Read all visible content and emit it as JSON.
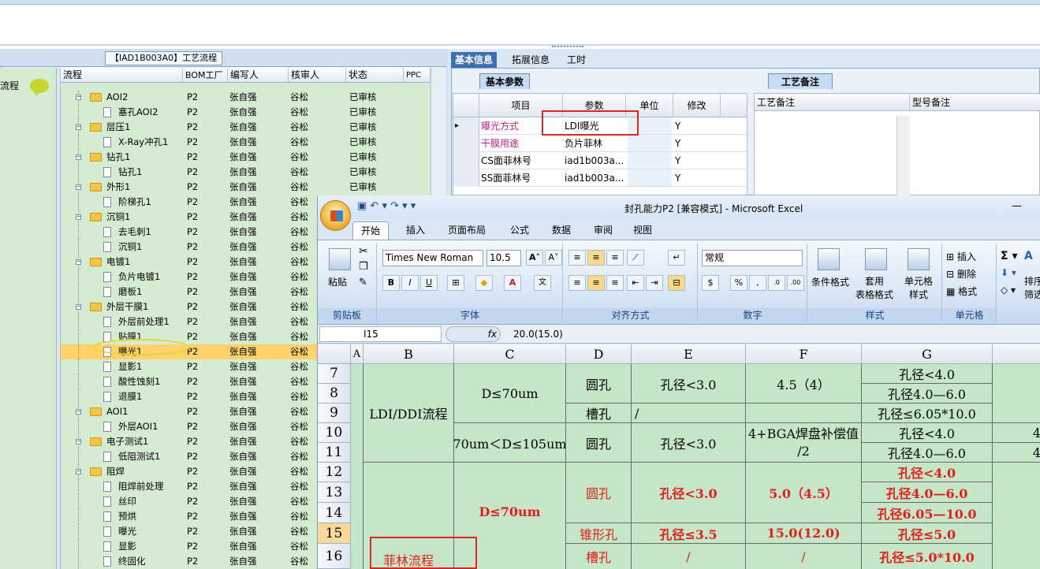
{
  "left_panel": {
    "title": "【IAD1B003A0】工艺流程",
    "nav_label": "流程",
    "columns": [
      "流程",
      "BOM工厂",
      "编写人",
      "核审人",
      "状态",
      "PPC"
    ],
    "rows": [
      {
        "name": "AOI2",
        "level": 1,
        "type": "folder",
        "bom": "P2",
        "writer": "张自强",
        "reviewer": "谷松",
        "status": "已审核"
      },
      {
        "name": "塞孔AOI2",
        "level": 2,
        "type": "doc",
        "bom": "P2",
        "writer": "张自强",
        "reviewer": "谷松",
        "status": "已审核"
      },
      {
        "name": "层压1",
        "level": 1,
        "type": "folder",
        "bom": "P2",
        "writer": "张自强",
        "reviewer": "谷松",
        "status": "已审核"
      },
      {
        "name": "X-Ray冲孔1",
        "level": 2,
        "type": "doc",
        "bom": "P2",
        "writer": "张自强",
        "reviewer": "谷松",
        "status": "已审核"
      },
      {
        "name": "钻孔1",
        "level": 1,
        "type": "folder",
        "bom": "P2",
        "writer": "张自强",
        "reviewer": "谷松",
        "status": "已审核"
      },
      {
        "name": "钻孔1",
        "level": 2,
        "type": "doc",
        "bom": "P2",
        "writer": "张自强",
        "reviewer": "谷松",
        "status": "已审核"
      },
      {
        "name": "外形1",
        "level": 1,
        "type": "folder",
        "bom": "P2",
        "writer": "张自强",
        "reviewer": "谷松",
        "status": "已审核"
      },
      {
        "name": "阶梯孔1",
        "level": 2,
        "type": "doc",
        "bom": "P2",
        "writer": "张自强",
        "reviewer": "谷松",
        "status": "已审核"
      },
      {
        "name": "沉铜1",
        "level": 1,
        "type": "folder",
        "bom": "P2",
        "writer": "张自强",
        "reviewer": "谷松",
        "status": ""
      },
      {
        "name": "去毛刺1",
        "level": 2,
        "type": "doc",
        "bom": "P2",
        "writer": "张自强",
        "reviewer": "谷松",
        "status": ""
      },
      {
        "name": "沉铜1",
        "level": 2,
        "type": "doc",
        "bom": "P2",
        "writer": "张自强",
        "reviewer": "谷松",
        "status": ""
      },
      {
        "name": "电镀1",
        "level": 1,
        "type": "folder",
        "bom": "P2",
        "writer": "张自强",
        "reviewer": "谷松",
        "status": ""
      },
      {
        "name": "负片电镀1",
        "level": 2,
        "type": "doc",
        "bom": "P2",
        "writer": "张自强",
        "reviewer": "谷松",
        "status": ""
      },
      {
        "name": "磨板1",
        "level": 2,
        "type": "doc",
        "bom": "P2",
        "writer": "张自强",
        "reviewer": "谷松",
        "status": ""
      },
      {
        "name": "外层干膜1",
        "level": 1,
        "type": "folder",
        "bom": "P2",
        "writer": "张自强",
        "reviewer": "谷松",
        "status": ""
      },
      {
        "name": "外层前处理1",
        "level": 2,
        "type": "doc",
        "bom": "P2",
        "writer": "张自强",
        "reviewer": "谷松",
        "status": ""
      },
      {
        "name": "贴膜1",
        "level": 2,
        "type": "doc",
        "bom": "P2",
        "writer": "张自强",
        "reviewer": "谷松",
        "status": ""
      },
      {
        "name": "曝光1",
        "level": 2,
        "type": "doc",
        "bom": "P2",
        "writer": "张自强",
        "reviewer": "谷松",
        "status": "",
        "selected": true
      },
      {
        "name": "显影1",
        "level": 2,
        "type": "doc",
        "bom": "P2",
        "writer": "张自强",
        "reviewer": "谷松",
        "status": ""
      },
      {
        "name": "酸性蚀刻1",
        "level": 2,
        "type": "doc",
        "bom": "P2",
        "writer": "张自强",
        "reviewer": "谷松",
        "status": ""
      },
      {
        "name": "退膜1",
        "level": 2,
        "type": "doc",
        "bom": "P2",
        "writer": "张自强",
        "reviewer": "谷松",
        "status": ""
      },
      {
        "name": "AOI1",
        "level": 1,
        "type": "folder",
        "bom": "P2",
        "writer": "张自强",
        "reviewer": "谷松",
        "status": ""
      },
      {
        "name": "外层AOI1",
        "level": 2,
        "type": "doc",
        "bom": "P2",
        "writer": "张自强",
        "reviewer": "谷松",
        "status": ""
      },
      {
        "name": "电子测试1",
        "level": 1,
        "type": "folder",
        "bom": "P2",
        "writer": "张自强",
        "reviewer": "谷松",
        "status": ""
      },
      {
        "name": "低阻测试1",
        "level": 2,
        "type": "doc",
        "bom": "P2",
        "writer": "张自强",
        "reviewer": "谷松",
        "status": ""
      },
      {
        "name": "阻焊",
        "level": 1,
        "type": "folder",
        "bom": "P2",
        "writer": "张自强",
        "reviewer": "谷松",
        "status": ""
      },
      {
        "name": "阻焊前处理",
        "level": 2,
        "type": "doc",
        "bom": "P2",
        "writer": "张自强",
        "reviewer": "谷松",
        "status": ""
      },
      {
        "name": "丝印",
        "level": 2,
        "type": "doc",
        "bom": "P2",
        "writer": "张自强",
        "reviewer": "谷松",
        "status": ""
      },
      {
        "name": "预烘",
        "level": 2,
        "type": "doc",
        "bom": "P2",
        "writer": "张自强",
        "reviewer": "谷松",
        "status": ""
      },
      {
        "name": "曝光",
        "level": 2,
        "type": "doc",
        "bom": "P2",
        "writer": "张自强",
        "reviewer": "谷松",
        "status": ""
      },
      {
        "name": "显影",
        "level": 2,
        "type": "doc",
        "bom": "P2",
        "writer": "张自强",
        "reviewer": "谷松",
        "status": ""
      },
      {
        "name": "终固化",
        "level": 2,
        "type": "doc",
        "bom": "P2",
        "writer": "张自强",
        "reviewer": "谷松",
        "status": ""
      }
    ]
  },
  "right_panel": {
    "tabs": [
      "基本信息",
      "拓展信息",
      "工时"
    ],
    "params_tab": "基本参数",
    "notes_tab": "工艺备注",
    "params_columns": [
      "项目",
      "参数",
      "单位",
      "修改"
    ],
    "params_rows": [
      {
        "item": "曝光方式",
        "value": "LDI曝光",
        "unit": "",
        "edit": "Y",
        "red": true
      },
      {
        "item": "干膜用途",
        "value": "负片菲林",
        "unit": "",
        "edit": "Y",
        "red": true
      },
      {
        "item": "CS面菲林号",
        "value": "iad1b003a...",
        "unit": "",
        "edit": "Y",
        "red": false
      },
      {
        "item": "SS面菲林号",
        "value": "iad1b003a...",
        "unit": "",
        "edit": "Y",
        "red": false
      }
    ],
    "notes_columns": [
      "工艺备注",
      "型号备注"
    ]
  },
  "excel": {
    "title": "封孔能力P2 [兼容模式] - Microsoft Excel",
    "tabs": [
      "开始",
      "插入",
      "页面布局",
      "公式",
      "数据",
      "审阅",
      "视图"
    ],
    "font_name": "Times New Roman",
    "font_size": "10.5",
    "number_format": "常规",
    "groups": {
      "clipboard": "剪贴板",
      "font": "字体",
      "align": "对齐方式",
      "number": "数字",
      "style": "样式",
      "cells": "单元格"
    },
    "buttons": {
      "paste": "粘贴",
      "cond_format": "条件格式",
      "table_format": "套用\n表格格式",
      "cell_style": "单元格\n样式",
      "insert": "插入",
      "delete": "删除",
      "format": "格式",
      "sort": "排序\n筛选"
    },
    "cell_ref": "I15",
    "formula": "20.0(15.0)",
    "columns": [
      "A",
      "B",
      "C",
      "D",
      "E",
      "F",
      "G"
    ],
    "rows": [
      "7",
      "8",
      "9",
      "10",
      "11",
      "12",
      "13",
      "14",
      "15",
      "16"
    ],
    "cells": {
      "b_ldi": "LDI/DDI流程",
      "b_film": "菲林流程",
      "c_d70": "D≤70um",
      "c_d70_105": "70um＜D≤105um",
      "c_d70_red": "D≤70um",
      "d_round": "圆孔",
      "d_slot": "槽孔",
      "d_round2": "圆孔",
      "d_round3": "圆孔",
      "d_cone": "锥形孔",
      "d_slot2": "槽孔",
      "e_r1": "孔径<3.0",
      "e_slash": "/",
      "e_r2": "孔径<3.0",
      "e_r3": "孔径<3.0",
      "e_cone": "孔径≤3.5",
      "e_slash2": "/",
      "f_r1": "4.5（4）",
      "f_r2": "4+BGA焊盘补偿值\n/2",
      "f_r3": "5.0（4.5）",
      "f_cone": "15.0(12.0)",
      "f_slash": "/",
      "g7": "孔径<4.0",
      "g8": "孔径4.0—6.0",
      "g9": "孔径≤6.05*10.0",
      "g10": "孔径<4.0",
      "g11": "孔径4.0—6.0",
      "g12": "孔径<4.0",
      "g13": "孔径4.0—6.0",
      "g14": "孔径6.05—10.0",
      "g15": "孔径≤5.0",
      "g16": "孔径≤5.0*10.0",
      "h10": "4",
      "h11": "4"
    }
  }
}
